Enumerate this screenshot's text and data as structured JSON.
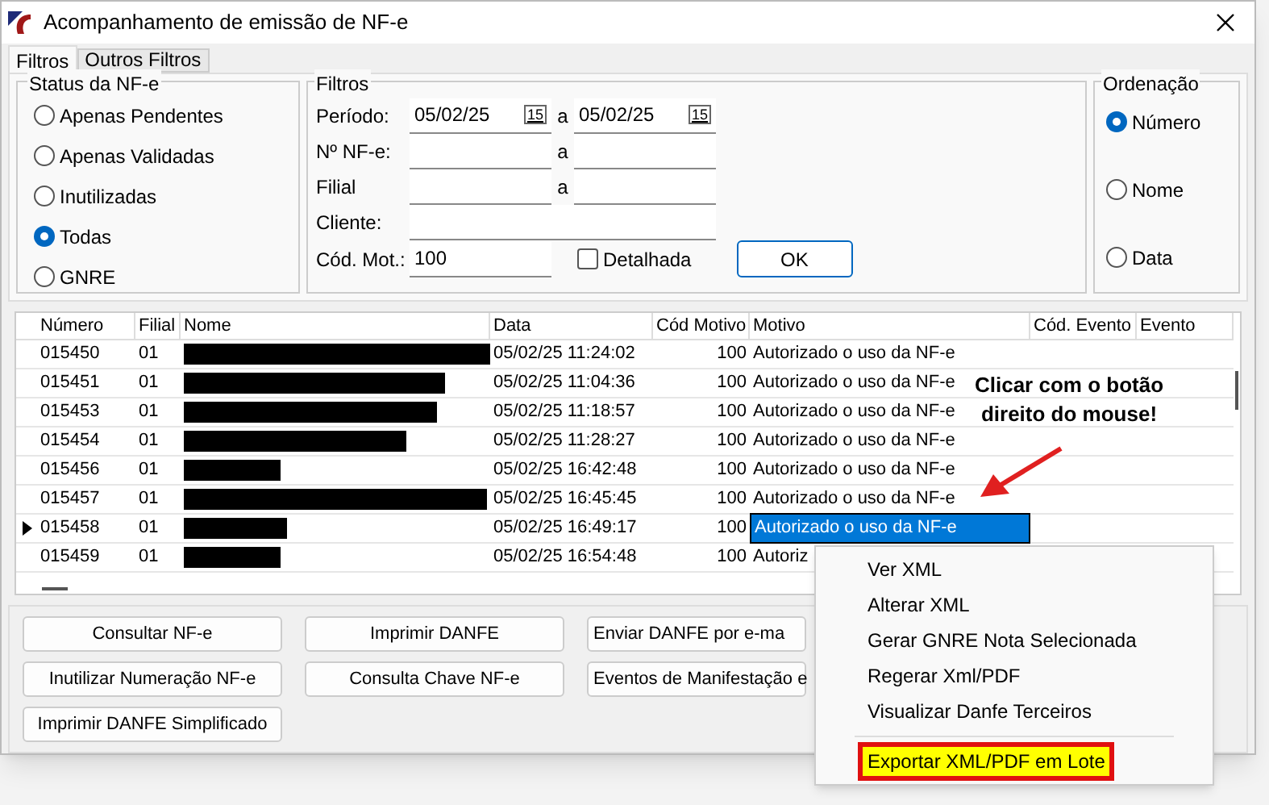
{
  "window": {
    "title": "Acompanhamento de emissão de NF-e"
  },
  "tabs": [
    {
      "label": "Filtros",
      "selected": true
    },
    {
      "label": "Outros Filtros",
      "selected": false
    }
  ],
  "status_group": {
    "title": "Status da NF-e",
    "options": [
      {
        "label": "Apenas Pendentes",
        "selected": false
      },
      {
        "label": "Apenas Validadas",
        "selected": false
      },
      {
        "label": "Inutilizadas",
        "selected": false
      },
      {
        "label": "Todas",
        "selected": true
      },
      {
        "label": "GNRE",
        "selected": false
      }
    ]
  },
  "filters": {
    "title": "Filtros",
    "periodo": {
      "label": "Período:",
      "from": "05/02/25",
      "to": "05/02/25",
      "sep": "a",
      "from_calendar": "15",
      "to_calendar": "15"
    },
    "numero": {
      "label": "Nº NF-e:",
      "sep": "a"
    },
    "filial": {
      "label": "Filial",
      "sep": "a"
    },
    "cliente": {
      "label": "Cliente:"
    },
    "cod_mot": {
      "label": "Cód. Mot.:",
      "value": "100"
    },
    "detalhada": {
      "label": "Detalhada",
      "checked": false
    },
    "ok": "OK"
  },
  "ordering": {
    "title": "Ordenação",
    "options": [
      {
        "label": "Número",
        "selected": true
      },
      {
        "label": "Nome",
        "selected": false
      },
      {
        "label": "Data",
        "selected": false
      }
    ]
  },
  "table": {
    "columns": [
      "Número",
      "Filial",
      "Nome",
      "Data",
      "Cód Motivo",
      "Motivo",
      "Cód. Evento",
      "Evento"
    ],
    "rows": [
      {
        "numero": "015450",
        "filial": "01",
        "data": "05/02/25 11:24:02",
        "cod": "100",
        "motivo": "Autorizado o uso da NF-e",
        "selected": false
      },
      {
        "numero": "015451",
        "filial": "01",
        "data": "05/02/25 11:04:36",
        "cod": "100",
        "motivo": "Autorizado o uso da NF-e",
        "selected": false
      },
      {
        "numero": "015453",
        "filial": "01",
        "data": "05/02/25 11:18:57",
        "cod": "100",
        "motivo": "Autorizado o uso da NF-e",
        "selected": false
      },
      {
        "numero": "015454",
        "filial": "01",
        "data": "05/02/25 11:28:27",
        "cod": "100",
        "motivo": "Autorizado o uso da NF-e",
        "selected": false
      },
      {
        "numero": "015456",
        "filial": "01",
        "data": "05/02/25 16:42:48",
        "cod": "100",
        "motivo": "Autorizado o uso da NF-e",
        "selected": false
      },
      {
        "numero": "015457",
        "filial": "01",
        "data": "05/02/25 16:45:45",
        "cod": "100",
        "motivo": "Autorizado o uso da NF-e",
        "selected": false
      },
      {
        "numero": "015458",
        "filial": "01",
        "data": "05/02/25 16:49:17",
        "cod": "100",
        "motivo": "Autorizado o uso da NF-e",
        "selected": true
      },
      {
        "numero": "015459",
        "filial": "01",
        "data": "05/02/25 16:54:48",
        "cod": "100",
        "motivo": "Autoriz",
        "selected": false
      }
    ]
  },
  "buttons": [
    [
      "Consultar NF-e",
      "Imprimir DANFE",
      "Enviar DANFE por e-ma"
    ],
    [
      "Inutilizar Numeração NF-e",
      "Consulta Chave NF-e",
      "Eventos de Manifestação e"
    ],
    [
      "Imprimir DANFE Simplificado"
    ]
  ],
  "context_menu": [
    {
      "label": "Ver XML",
      "highlighted": false
    },
    {
      "label": "Alterar XML",
      "highlighted": false
    },
    {
      "label": "Gerar GNRE Nota Selecionada",
      "highlighted": false
    },
    {
      "label": "Regerar Xml/PDF",
      "highlighted": false
    },
    {
      "label": "Visualizar Danfe Terceiros",
      "highlighted": false
    },
    {
      "label": "Exportar XML/PDF em Lote",
      "highlighted": true
    }
  ],
  "annotation": "Clicar com o botão direito do mouse!"
}
